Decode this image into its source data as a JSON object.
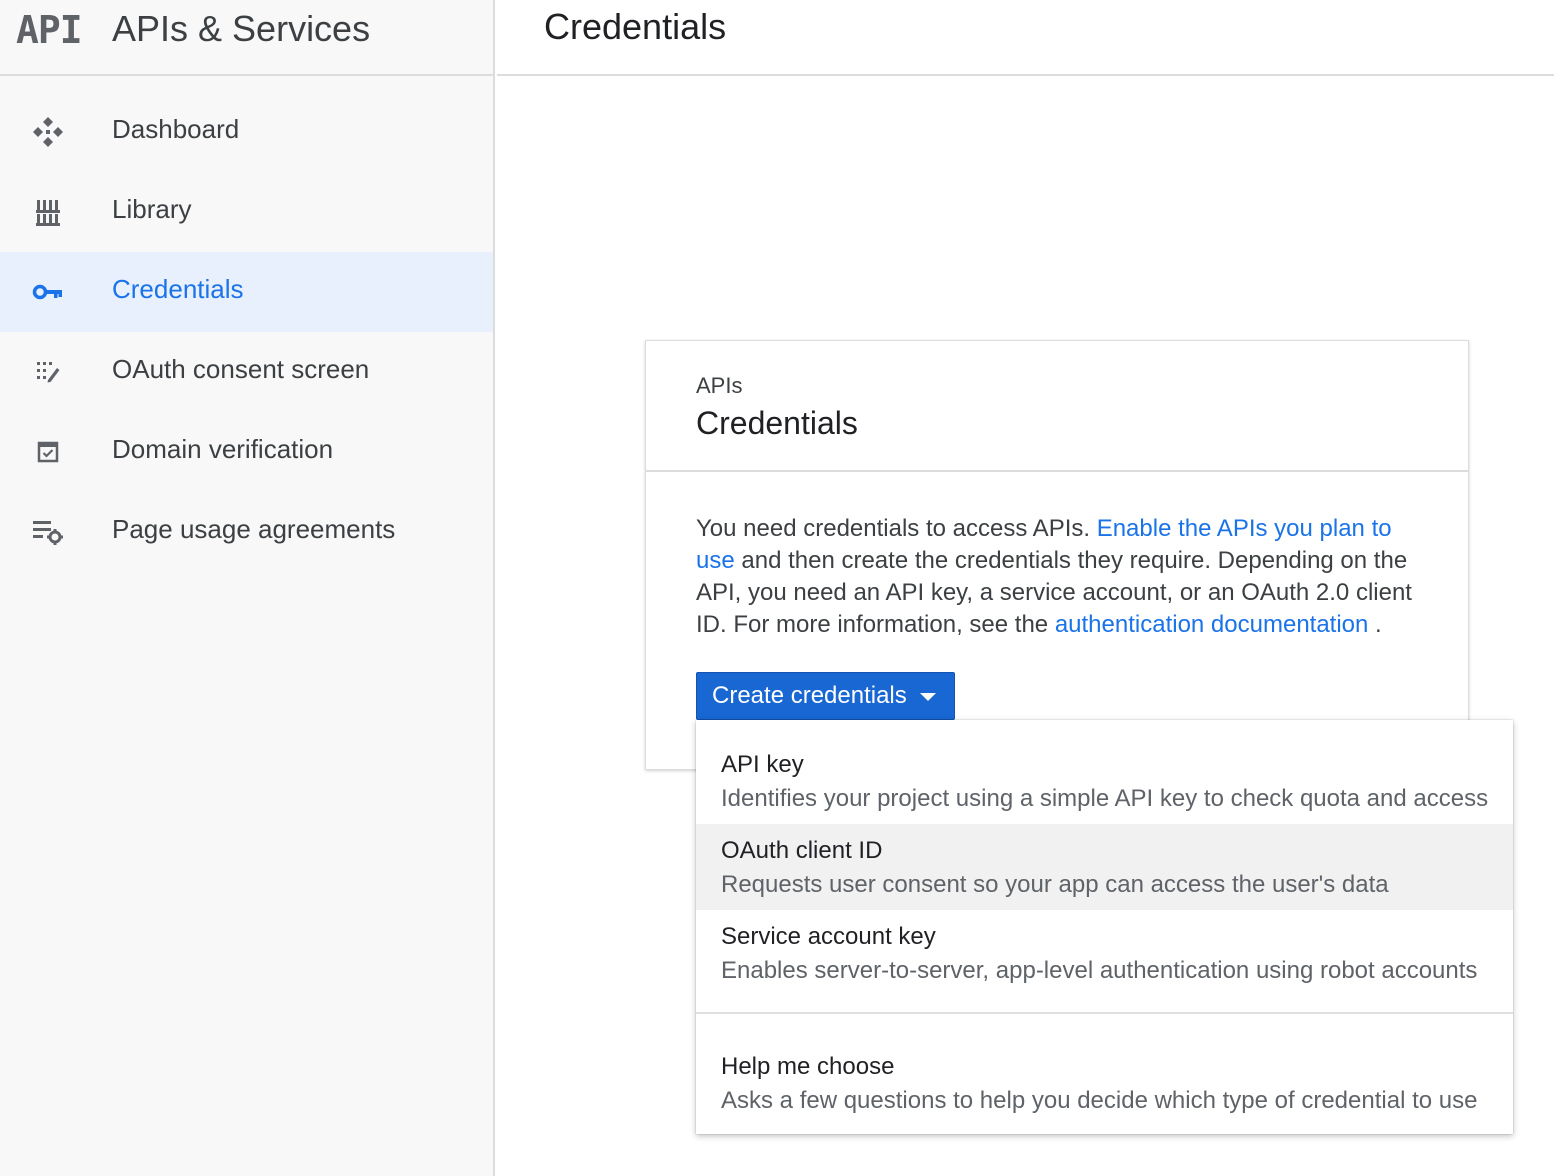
{
  "sidebar": {
    "logo_text": "API",
    "product_title": "APIs & Services",
    "items": [
      {
        "label": "Dashboard",
        "icon": "dashboard-icon"
      },
      {
        "label": "Library",
        "icon": "library-icon"
      },
      {
        "label": "Credentials",
        "icon": "key-icon",
        "active": true
      },
      {
        "label": "OAuth consent screen",
        "icon": "consent-icon"
      },
      {
        "label": "Domain verification",
        "icon": "checkbox-icon"
      },
      {
        "label": "Page usage agreements",
        "icon": "settings-list-icon"
      }
    ]
  },
  "header": {
    "title": "Credentials"
  },
  "card": {
    "subtitle": "APIs",
    "title": "Credentials",
    "text_1": "You need credentials to access APIs. ",
    "link_1": "Enable the APIs you plan to use",
    "text_2": " and then create the credentials they require. Depending on the API, you need an API key, a service account, or an OAuth 2.0 client ID. For more information, see the ",
    "link_2": "authentication documentation",
    "text_3": " .",
    "button_label": "Create credentials"
  },
  "menu": {
    "items": [
      {
        "title": "API key",
        "description": "Identifies your project using a simple API key to check quota and access"
      },
      {
        "title": "OAuth client ID",
        "description": "Requests user consent so your app can access the user's data"
      },
      {
        "title": "Service account key",
        "description": "Enables server-to-server, app-level authentication using robot accounts"
      },
      {
        "title": "Help me choose",
        "description": "Asks a few questions to help you decide which type of credential to use"
      }
    ]
  },
  "colors": {
    "accent": "#1a73e8",
    "button": "#1967d2",
    "active_bg": "#e8f0fe"
  }
}
